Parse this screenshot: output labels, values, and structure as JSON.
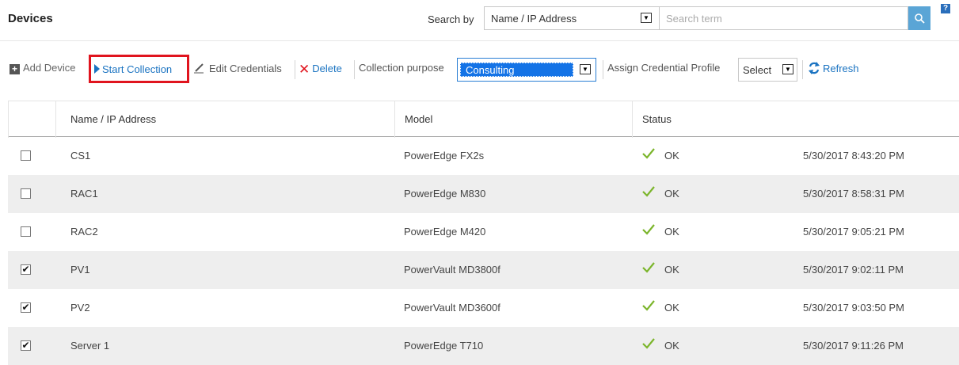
{
  "header": {
    "title": "Devices",
    "search_by_label": "Search by",
    "search_by_value": "Name / IP Address",
    "search_placeholder": "Search term",
    "help": "?"
  },
  "toolbar": {
    "add_device": "Add Device",
    "start_collection": "Start Collection",
    "edit_credentials": "Edit Credentials",
    "delete": "Delete",
    "collection_purpose_label": "Collection purpose",
    "collection_purpose_value": "Consulting",
    "assign_profile_label": "Assign Credential Profile",
    "assign_profile_value": "Select",
    "refresh": "Refresh"
  },
  "table": {
    "columns": [
      "Name / IP Address",
      "Model",
      "Status"
    ],
    "rows": [
      {
        "checked": false,
        "name": "CS1",
        "model": "PowerEdge FX2s",
        "status": "OK",
        "timestamp": "5/30/2017 8:43:20 PM"
      },
      {
        "checked": false,
        "name": "RAC1",
        "model": "PowerEdge M830",
        "status": "OK",
        "timestamp": "5/30/2017 8:58:31 PM"
      },
      {
        "checked": false,
        "name": "RAC2",
        "model": "PowerEdge M420",
        "status": "OK",
        "timestamp": "5/30/2017 9:05:21 PM"
      },
      {
        "checked": true,
        "name": "PV1",
        "model": "PowerVault MD3800f",
        "status": "OK",
        "timestamp": "5/30/2017 9:02:11 PM"
      },
      {
        "checked": true,
        "name": "PV2",
        "model": "PowerVault MD3600f",
        "status": "OK",
        "timestamp": "5/30/2017 9:03:50 PM"
      },
      {
        "checked": true,
        "name": "Server 1",
        "model": "PowerEdge T710",
        "status": "OK",
        "timestamp": "5/30/2017 9:11:26 PM"
      }
    ]
  },
  "colors": {
    "link": "#1a73c1",
    "highlight_border": "#e0141e",
    "ok_check": "#7bb52b",
    "search_button": "#5aa5d6",
    "selected_option": "#1473e6"
  }
}
